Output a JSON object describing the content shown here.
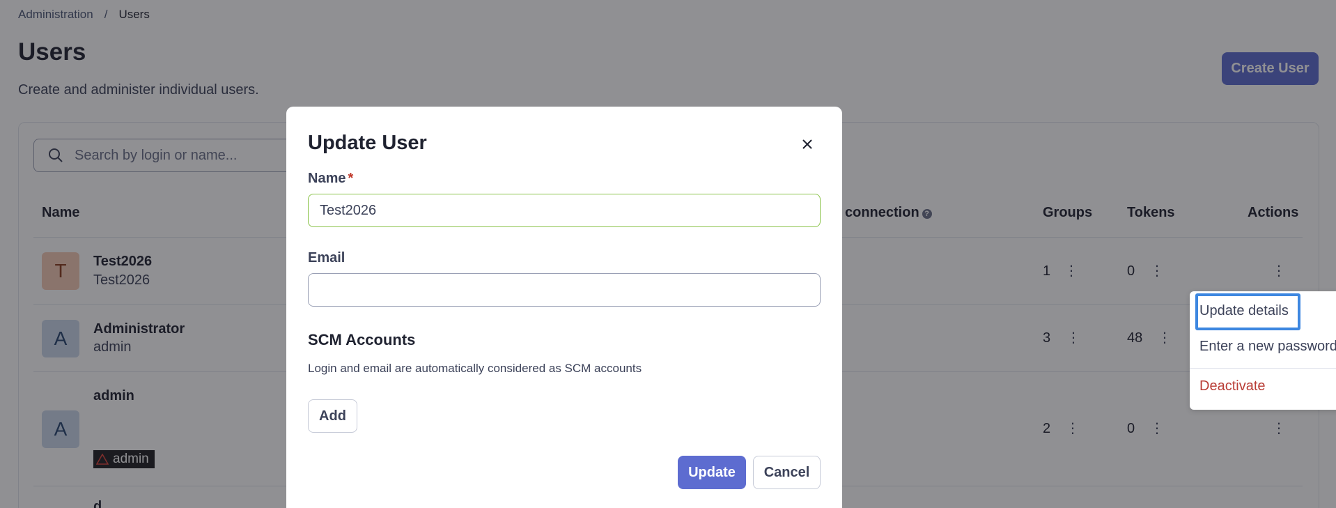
{
  "breadcrumb": {
    "parent": "Administration",
    "separator": "/",
    "current": "Users"
  },
  "page": {
    "title": "Users",
    "description": "Create and administer individual users.",
    "create_button": "Create User"
  },
  "search": {
    "placeholder": "Search by login or name..."
  },
  "table": {
    "headers": {
      "name": "Name",
      "connection": "connection",
      "groups": "Groups",
      "tokens": "Tokens",
      "actions": "Actions"
    },
    "rows": [
      {
        "initial": "T",
        "name": "Test2026",
        "login": "Test2026",
        "groups": "1",
        "tokens": "0"
      },
      {
        "initial": "A",
        "name": "Administrator",
        "login": "admin",
        "groups": "3",
        "tokens": "48"
      },
      {
        "initial": "A",
        "name": "admin",
        "badge": "admin",
        "groups": "2",
        "tokens": "0"
      }
    ],
    "partial_row_name": "d..."
  },
  "action_menu": {
    "items": [
      "Update details",
      "Enter a new password",
      "Deactivate"
    ]
  },
  "modal": {
    "title": "Update User",
    "name_label": "Name",
    "required_mark": "*",
    "name_value": "Test2026",
    "email_label": "Email",
    "email_value": "",
    "scm_title": "SCM Accounts",
    "scm_description": "Login and email are automatically considered as SCM accounts",
    "add_button": "Add",
    "update_button": "Update",
    "cancel_button": "Cancel"
  },
  "colors": {
    "accent": "#5d6cd0",
    "focus": "#3d87e0",
    "danger": "#b93d36",
    "valid": "#8bc34a"
  },
  "icons": {
    "search": "search-icon",
    "close": "close-icon",
    "kebab": "kebab-icon",
    "help": "help-icon",
    "warning": "warning-icon"
  }
}
